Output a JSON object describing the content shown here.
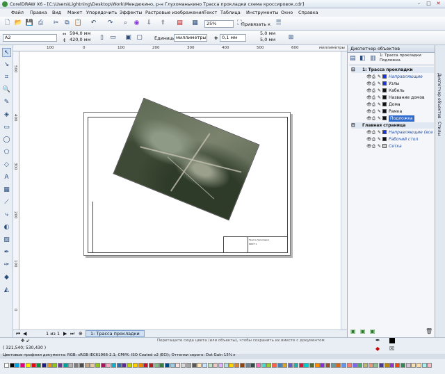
{
  "window": {
    "title": "CorelDRAW X6 - [C:\\Users\\Lightning\\Desktop\\Work\\Мендюкино, р-н Глухоманькино Трасса прокладки схема кроссировок.cdr]",
    "min": "–",
    "max": "□",
    "close": "✕"
  },
  "menu": [
    "Файл",
    "Правка",
    "Вид",
    "Макет",
    "Упорядочить",
    "Эффекты",
    "Растровые изображения",
    "Текст",
    "Таблица",
    "Инструменты",
    "Окно",
    "Справка"
  ],
  "toolbar": {
    "zoom": "25%",
    "snap": "Привязать к"
  },
  "propbar": {
    "page_size": "A2",
    "width": "594,0 мм",
    "height": "420,0 мм",
    "units_label": "Единицы:",
    "units": "миллиметры",
    "nudge": "0,1 мм",
    "dup_x": "5,0 мм",
    "dup_y": "5,0 мм"
  },
  "ruler": {
    "h_ticks": [
      "300",
      "200",
      "100",
      "0",
      "100",
      "200",
      "300",
      "400",
      "500",
      "600"
    ],
    "h_unit": "миллиметры",
    "v_ticks": [
      "500",
      "400",
      "300",
      "200",
      "100",
      "0"
    ]
  },
  "titleblock": {
    "line1": "Трасса прокладки",
    "line2": "ЛИСТ 1"
  },
  "docker": {
    "title": "Диспетчер объектов",
    "page_label": "1: Трасса прокладки",
    "layer_label": "Подложка",
    "items": [
      {
        "label": "1: Трасса прокладки",
        "type": "page"
      },
      {
        "label": "Направляющие",
        "color": "#1a35d8",
        "italic": true
      },
      {
        "label": "Узлы",
        "color": "#1a35d8"
      },
      {
        "label": "Кабель",
        "color": "#111111"
      },
      {
        "label": "Название домов",
        "color": "#111111"
      },
      {
        "label": "Дома",
        "color": "#111111"
      },
      {
        "label": "Рамка",
        "color": "#111111"
      },
      {
        "label": "Подложка",
        "color": "#111111",
        "selected": true
      },
      {
        "label": "Главная страница",
        "type": "page"
      },
      {
        "label": "Направляющие (все с...",
        "color": "#1a35d8",
        "italic": true
      },
      {
        "label": "Рабочий стол",
        "color": "#111111",
        "italic": true
      },
      {
        "label": "Сетка",
        "color": "#cccccc",
        "italic": true
      }
    ]
  },
  "sidetabs": [
    "Диспетчер объектов",
    "Стилы"
  ],
  "pages": {
    "counter": "1 из 1",
    "tab": "1: Трасса прокладки"
  },
  "status": {
    "hint": "Перетащите сюда цвета (или объекты), чтобы сохранить их вместе с документом",
    "coords": "( 321,540; 530,430 )",
    "profile": "Цветовые профили документа: RGB: sRGB IEC61966-2.1; CMYK: ISO Coated v2 (ECI); Оттенки серого: Dot Gain 15% ▸"
  },
  "palette_colors": [
    "#ffffff",
    "#000000",
    "#00a0e6",
    "#e6007e",
    "#ffed00",
    "#e30613",
    "#009640",
    "#1d1d8f",
    "#f39200",
    "#8fc31f",
    "#6c3b8b",
    "#00a19a",
    "#b2b2b2",
    "#7f7f7f",
    "#4d4d4d",
    "#c7a47a",
    "#e8c9a0",
    "#95c11f",
    "#a3195b",
    "#f6a6c1",
    "#00b4d8",
    "#2e6fb4",
    "#5c2d91",
    "#c8d400",
    "#ffcc00",
    "#f08a00",
    "#d60a2b",
    "#b71c1c",
    "#7fbf7f",
    "#3a7d44",
    "#004b87",
    "#9ecae1",
    "#fde0dd",
    "#d9d9d9",
    "#a6a6a6",
    "#595959",
    "#ffe5b4",
    "#cce5ff",
    "#c2e0c6",
    "#f4c7c3",
    "#e0b0ff",
    "#b0e0e6",
    "#ffd700",
    "#cd853f",
    "#8b4513",
    "#708090",
    "#2f4f4f",
    "#ff69b4",
    "#40e0d0",
    "#9acd32",
    "#ff6347",
    "#4682b4",
    "#daa520",
    "#6a5acd",
    "#20b2aa",
    "#dc143c",
    "#00ced1",
    "#556b2f",
    "#ff8c00",
    "#8a2be2",
    "#a0522d",
    "#5f9ea0",
    "#d2691e",
    "#6495ed",
    "#fa8072",
    "#7b68ee",
    "#3cb371",
    "#bdb76b",
    "#e9967a",
    "#8fbc8f",
    "#483d8b",
    "#b8860b",
    "#9932cc",
    "#ff4500",
    "#2e8b57",
    "#d8bfd8",
    "#f5deb3",
    "#ffdead",
    "#afeeee",
    "#ffb6c1"
  ]
}
